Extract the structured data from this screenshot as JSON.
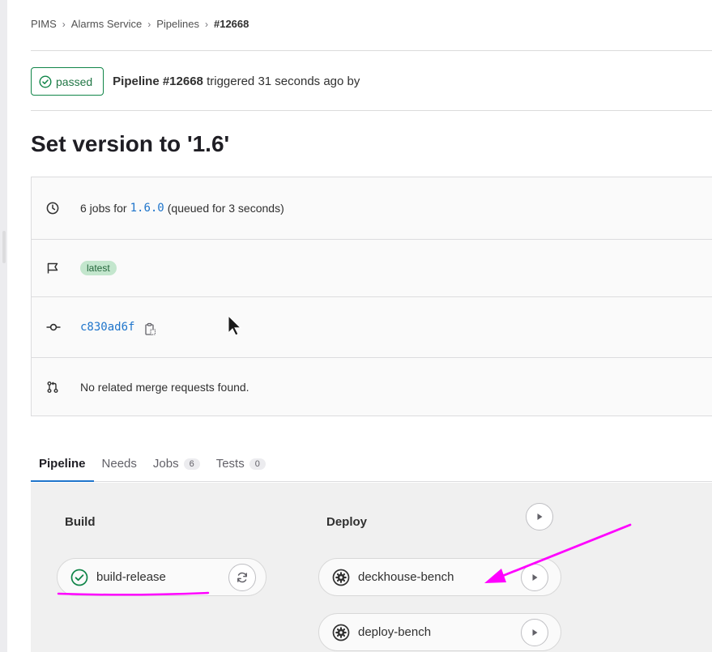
{
  "breadcrumb": {
    "items": [
      "PIMS",
      "Alarms Service",
      "Pipelines"
    ],
    "current": "#12668"
  },
  "status": {
    "badge": "passed",
    "pipeline_label": "Pipeline #12668",
    "triggered_text": " triggered 31 seconds ago by"
  },
  "title": "Set version to '1.6'",
  "info": {
    "jobs_prefix": "6 jobs for",
    "ref": "1.6.0",
    "jobs_suffix": "(queued for 3 seconds)",
    "tag": "latest",
    "commit": "c830ad6f",
    "merge_requests": "No related merge requests found."
  },
  "tabs": [
    {
      "label": "Pipeline",
      "count": null
    },
    {
      "label": "Needs",
      "count": null
    },
    {
      "label": "Jobs",
      "count": "6"
    },
    {
      "label": "Tests",
      "count": "0"
    }
  ],
  "stages": [
    {
      "title": "Build",
      "jobs": [
        {
          "name": "build-release",
          "status": "success",
          "action": "retry"
        }
      ]
    },
    {
      "title": "Deploy",
      "jobs": [
        {
          "name": "deckhouse-bench",
          "status": "manual",
          "action": "play"
        },
        {
          "name": "deploy-bench",
          "status": "manual",
          "action": "play"
        }
      ]
    }
  ],
  "icons": [
    "check-circle-icon",
    "clock-icon",
    "flag-icon",
    "commit-icon",
    "copy-icon",
    "merge-request-icon",
    "retry-icon",
    "gear-icon",
    "play-icon",
    "cursor-icon"
  ],
  "colors": {
    "success": "#108548",
    "link": "#1f75cb",
    "annotation": "#ff00ff",
    "tag_bg": "#c3e6cd"
  }
}
